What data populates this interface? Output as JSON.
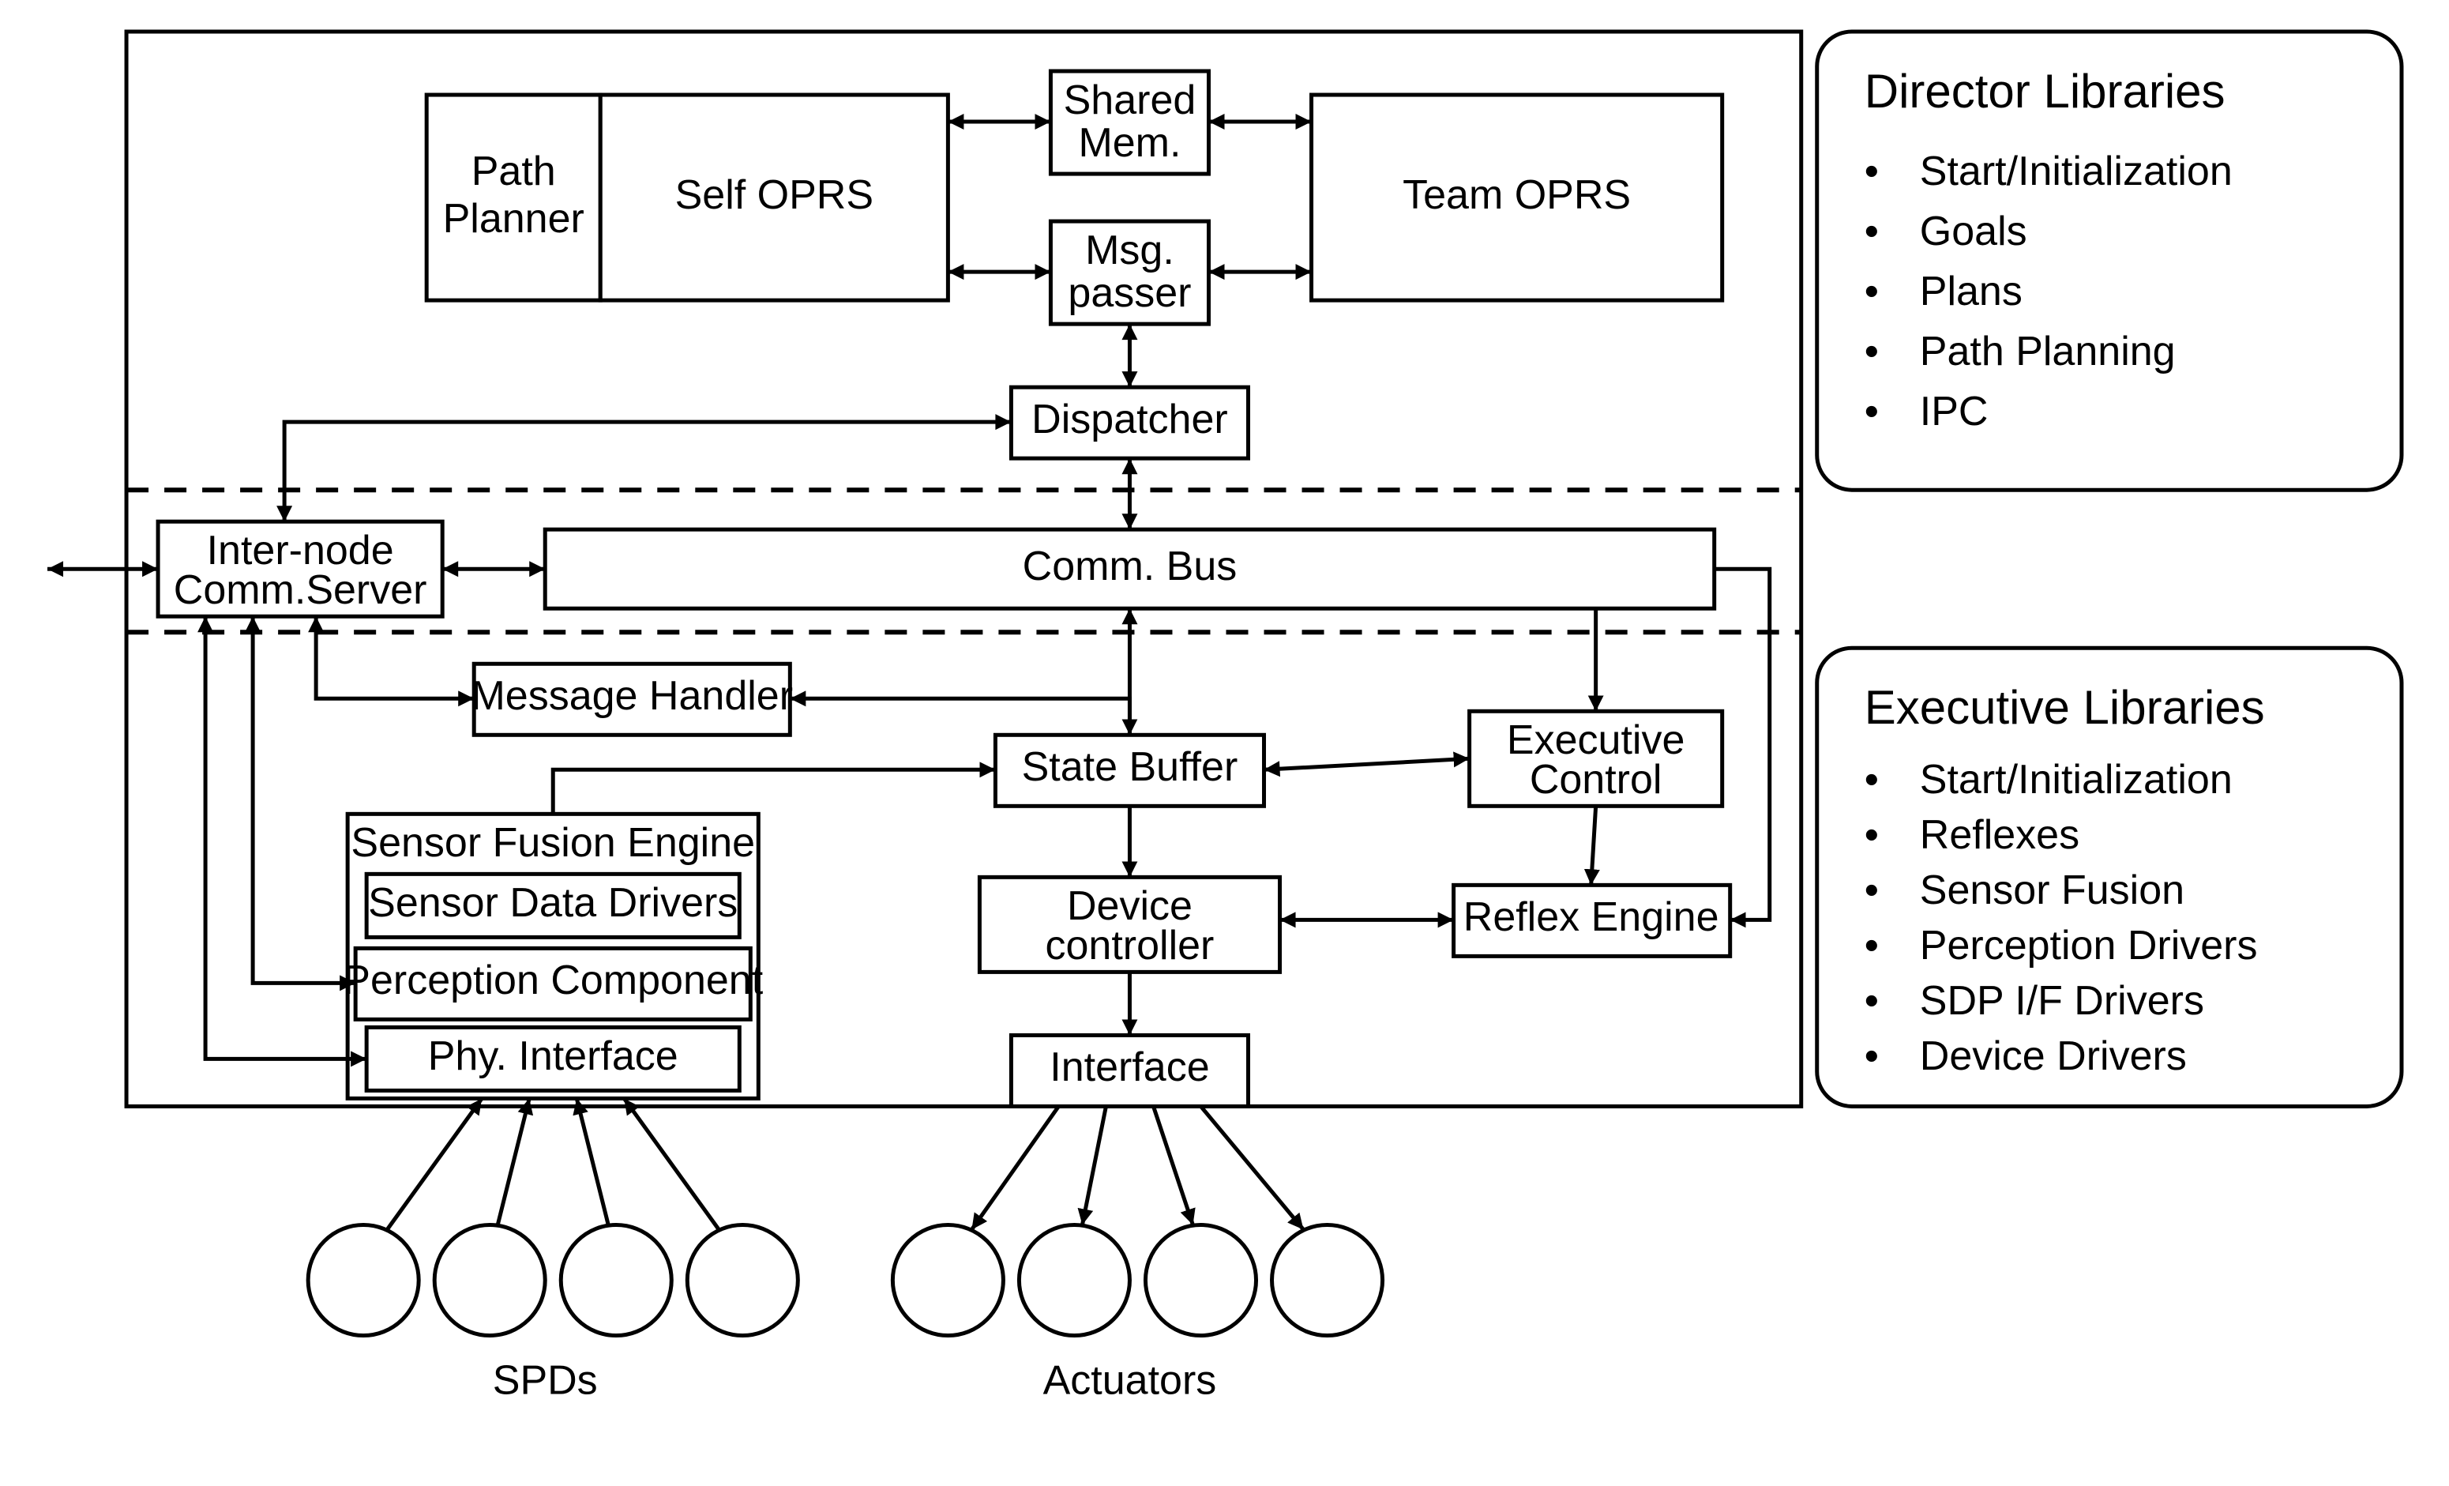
{
  "boxes": {
    "path_planner": {
      "l1": "Path",
      "l2": "Planner"
    },
    "self_oprs": "Self OPRS",
    "shared_mem": {
      "l1": "Shared",
      "l2": "Mem."
    },
    "msg_passer": {
      "l1": "Msg.",
      "l2": "passer"
    },
    "team_oprs": "Team OPRS",
    "dispatcher": "Dispatcher",
    "inter_node": {
      "l1": "Inter-node",
      "l2": "Comm.Server"
    },
    "comm_bus": "Comm. Bus",
    "msg_handler": "Message Handler",
    "state_buffer": "State Buffer",
    "exec_control": {
      "l1": "Executive",
      "l2": "Control"
    },
    "sensor_fusion": "Sensor Fusion Engine",
    "sensor_drivers": "Sensor Data Drivers",
    "perception": "Perception Component",
    "phy_iface": "Phy. Interface",
    "device_ctrl": {
      "l1": "Device",
      "l2": "controller"
    },
    "reflex": "Reflex Engine",
    "interface": "Interface"
  },
  "labels": {
    "spds": "SPDs",
    "actuators": "Actuators"
  },
  "panels": {
    "director": {
      "title": "Director Libraries",
      "items": [
        "Start/Initialization",
        "Goals",
        "Plans",
        "Path Planning",
        "IPC"
      ]
    },
    "executive": {
      "title": "Executive Libraries",
      "items": [
        "Start/Initialization",
        "Reflexes",
        "Sensor Fusion",
        "Perception Drivers",
        "SDP I/F Drivers",
        "Device Drivers"
      ]
    }
  }
}
